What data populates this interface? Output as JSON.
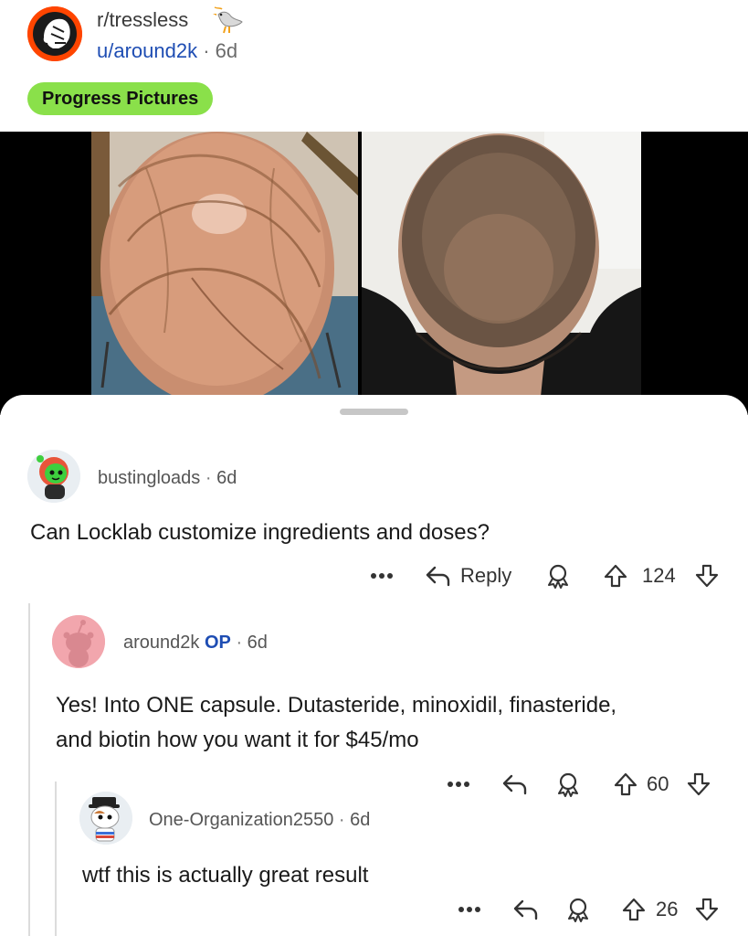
{
  "post": {
    "subreddit": "r/tressless",
    "author": "u/around2k",
    "separator": "·",
    "age": "6d",
    "flair": "Progress Pictures",
    "flair_color": "#8ae04a",
    "subreddit_icon": "bald-head-icon",
    "badge_icon": "seagull-icon"
  },
  "media": {
    "images": [
      "hair-before-photo",
      "hair-after-photo"
    ]
  },
  "comments": [
    {
      "author": "bustingloads",
      "op_tag": "",
      "separator": "·",
      "age": "6d",
      "body": "Can Locklab customize ingredients and doses?",
      "reply_label": "Reply",
      "score": "124",
      "more_icon": "more-dots-icon"
    },
    {
      "author": "around2k",
      "op_tag": "OP",
      "separator": "·",
      "age": "6d",
      "body_line1": "Yes! Into ONE capsule. Dutasteride, minoxidil, finasteride,",
      "body_line2": "and biotin how you want it for $45/mo",
      "score": "60"
    },
    {
      "author": "One-Organization2550",
      "op_tag": "",
      "separator": "·",
      "age": "6d",
      "body": "wtf this is actually great result",
      "score": "26"
    }
  ],
  "colors": {
    "op_tag": "#1e4db3",
    "username_link": "#1e4db3",
    "subreddit_accent": "#ff4500"
  }
}
